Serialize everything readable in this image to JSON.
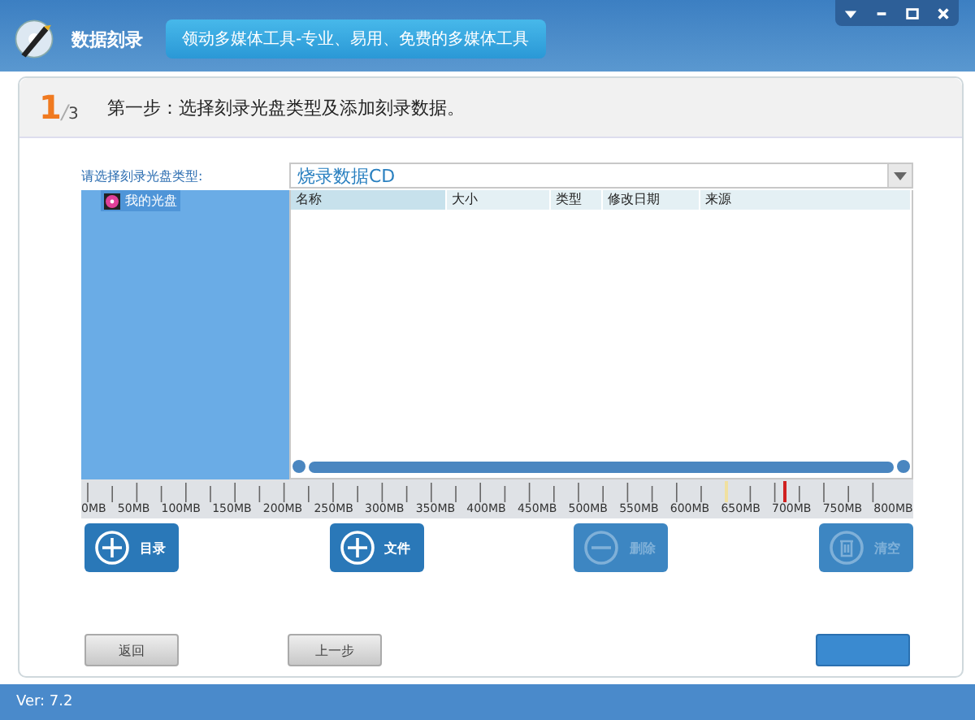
{
  "window": {
    "title": "数据刻录",
    "slogan": "领动多媒体工具-专业、易用、免费的多媒体工具"
  },
  "window_controls": [
    {
      "kind": "menu"
    },
    {
      "kind": "minimize"
    },
    {
      "kind": "maximize"
    },
    {
      "kind": "close"
    }
  ],
  "step": {
    "current": "1",
    "separator": "/",
    "total": "3",
    "text": "第一步：选择刻录光盘类型及添加刻录数据。"
  },
  "disc_type": {
    "label": "请选择刻录光盘类型:",
    "value": "烧录数据CD"
  },
  "tree": [
    {
      "label": "我的光盘",
      "selected": true
    }
  ],
  "table": {
    "columns": [
      "名称",
      "大小",
      "类型",
      "修改日期",
      "来源"
    ]
  },
  "ruler": {
    "labels": [
      "0MB",
      "50MB",
      "100MB",
      "150MB",
      "200MB",
      "250MB",
      "300MB",
      "350MB",
      "400MB",
      "450MB",
      "500MB",
      "550MB",
      "600MB",
      "650MB",
      "700MB",
      "750MB",
      "800MB"
    ]
  },
  "actions": [
    {
      "kind": "add",
      "label": "目录",
      "disabled": false
    },
    {
      "kind": "add",
      "label": "文件",
      "disabled": false
    },
    {
      "kind": "remove",
      "label": "删除",
      "disabled": true
    },
    {
      "kind": "clear",
      "label": "清空",
      "disabled": true
    }
  ],
  "nav": [
    {
      "label": "返回",
      "kind": "grey"
    },
    {
      "label": "上一步",
      "kind": "grey"
    },
    {
      "kind": "primary"
    }
  ],
  "status_bar": {
    "version": "Ver: 7.2"
  }
}
